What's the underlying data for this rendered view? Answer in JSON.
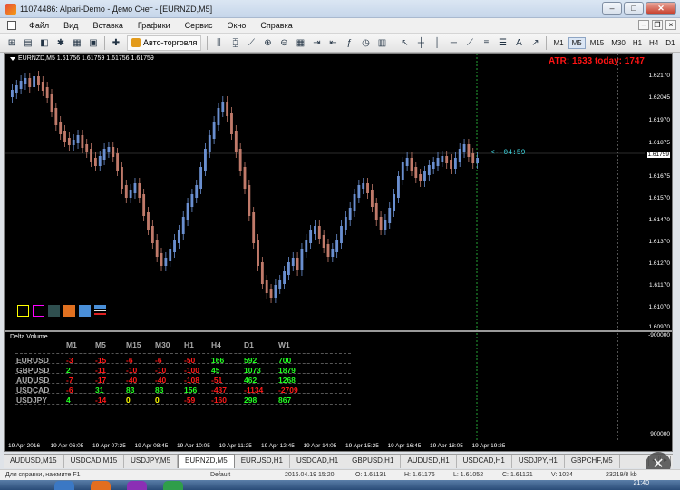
{
  "window": {
    "title": "11074486: Alpari-Demo - Демо Счет - [EURNZD,M5]"
  },
  "menu": {
    "items": [
      "Файл",
      "Вид",
      "Вставка",
      "Графики",
      "Сервис",
      "Окно",
      "Справка"
    ]
  },
  "toolbar": {
    "autotrade_label": "Авто-торговля",
    "timeframes": [
      "M1",
      "M5",
      "M15",
      "M30",
      "H1",
      "H4",
      "D1"
    ],
    "active_timeframe": "M5"
  },
  "chart": {
    "header": "EURNZD,M5  1.61756 1.61759 1.61756 1.61759",
    "atr_text": "ATR: 1633  today: 1747",
    "timer_label": "<--04:59",
    "current_price": "1.61759",
    "price_labels": [
      "1.62170",
      "1.62045",
      "1.61970",
      "1.61875",
      "1.61759",
      "1.61675",
      "1.61570",
      "1.61470",
      "1.61370",
      "1.61270",
      "1.61170",
      "1.61070",
      "1.60970"
    ],
    "sub_window_title": "Delta Volume",
    "sub_axis_top": "-900000",
    "sub_axis_bottom": "900000",
    "indicator_colors": [
      "#ffff00",
      "#ff00ff",
      "#2f4f4f",
      "#e07020",
      "#4a8fd8",
      "#4a8fd8"
    ],
    "time_labels": [
      "19 Apr 2016",
      "19 Apr 06:05",
      "19 Apr 07:25",
      "19 Apr 08:45",
      "19 Apr 10:05",
      "19 Apr 11:25",
      "19 Apr 12:45",
      "19 Apr 14:05",
      "19 Apr 15:25",
      "19 Apr 16:45",
      "19 Apr 18:05",
      "19 Apr 19:25"
    ]
  },
  "delta_table": {
    "headers": [
      "M1",
      "M5",
      "M15",
      "M30",
      "H1",
      "H4",
      "D1",
      "W1"
    ],
    "rows": [
      {
        "symbol": "EURUSD",
        "values": [
          "-3",
          "-15",
          "-6",
          "-6",
          "-50",
          "166",
          "592",
          "700"
        ],
        "colors": [
          "r",
          "r",
          "r",
          "r",
          "r",
          "g",
          "g",
          "g"
        ]
      },
      {
        "symbol": "GBPUSD",
        "values": [
          "2",
          "-11",
          "-10",
          "-10",
          "-100",
          "45",
          "1073",
          "1879"
        ],
        "colors": [
          "g",
          "r",
          "r",
          "r",
          "r",
          "g",
          "g",
          "g"
        ]
      },
      {
        "symbol": "AUDUSD",
        "values": [
          "-7",
          "-17",
          "-40",
          "-40",
          "-108",
          "-51",
          "462",
          "1268"
        ],
        "colors": [
          "r",
          "r",
          "r",
          "r",
          "r",
          "r",
          "g",
          "g"
        ]
      },
      {
        "symbol": "USDCAD",
        "values": [
          "-6",
          "31",
          "83",
          "83",
          "156",
          "-437",
          "-1134",
          "-2709"
        ],
        "colors": [
          "r",
          "g",
          "g",
          "g",
          "g",
          "r",
          "r",
          "r"
        ]
      },
      {
        "symbol": "USDJPY",
        "values": [
          "4",
          "-14",
          "0",
          "0",
          "-59",
          "-160",
          "298",
          "867"
        ],
        "colors": [
          "g",
          "r",
          "y",
          "y",
          "r",
          "r",
          "g",
          "g"
        ]
      }
    ]
  },
  "tabs": {
    "items": [
      "AUDUSD,M15",
      "USDCAD,M15",
      "USDJPY,M5",
      "EURNZD,M5",
      "EURUSD,H1",
      "USDCAD,H1",
      "GBPUSD,H1",
      "AUDUSD,H1",
      "USDCAD,H1",
      "USDJPY,H1",
      "GBPCHF,M5"
    ],
    "active_index": 3
  },
  "status": {
    "help": "Для справки, нажмите F1",
    "profile": "Default",
    "datetime": "2016.04.19 15:20",
    "open": "O: 1.61131",
    "high": "H: 1.61176",
    "low": "L: 1.61052",
    "close": "C: 1.61121",
    "volume": "V: 1034",
    "traffic": "23219/8 kb"
  },
  "taskbar": {
    "clock": "21:40"
  },
  "colors": {
    "red": "#ff1a1a",
    "green": "#22ff22",
    "yellow": "#ffff00",
    "bull": "#6a8fd0",
    "bear": "#c07a6a"
  }
}
